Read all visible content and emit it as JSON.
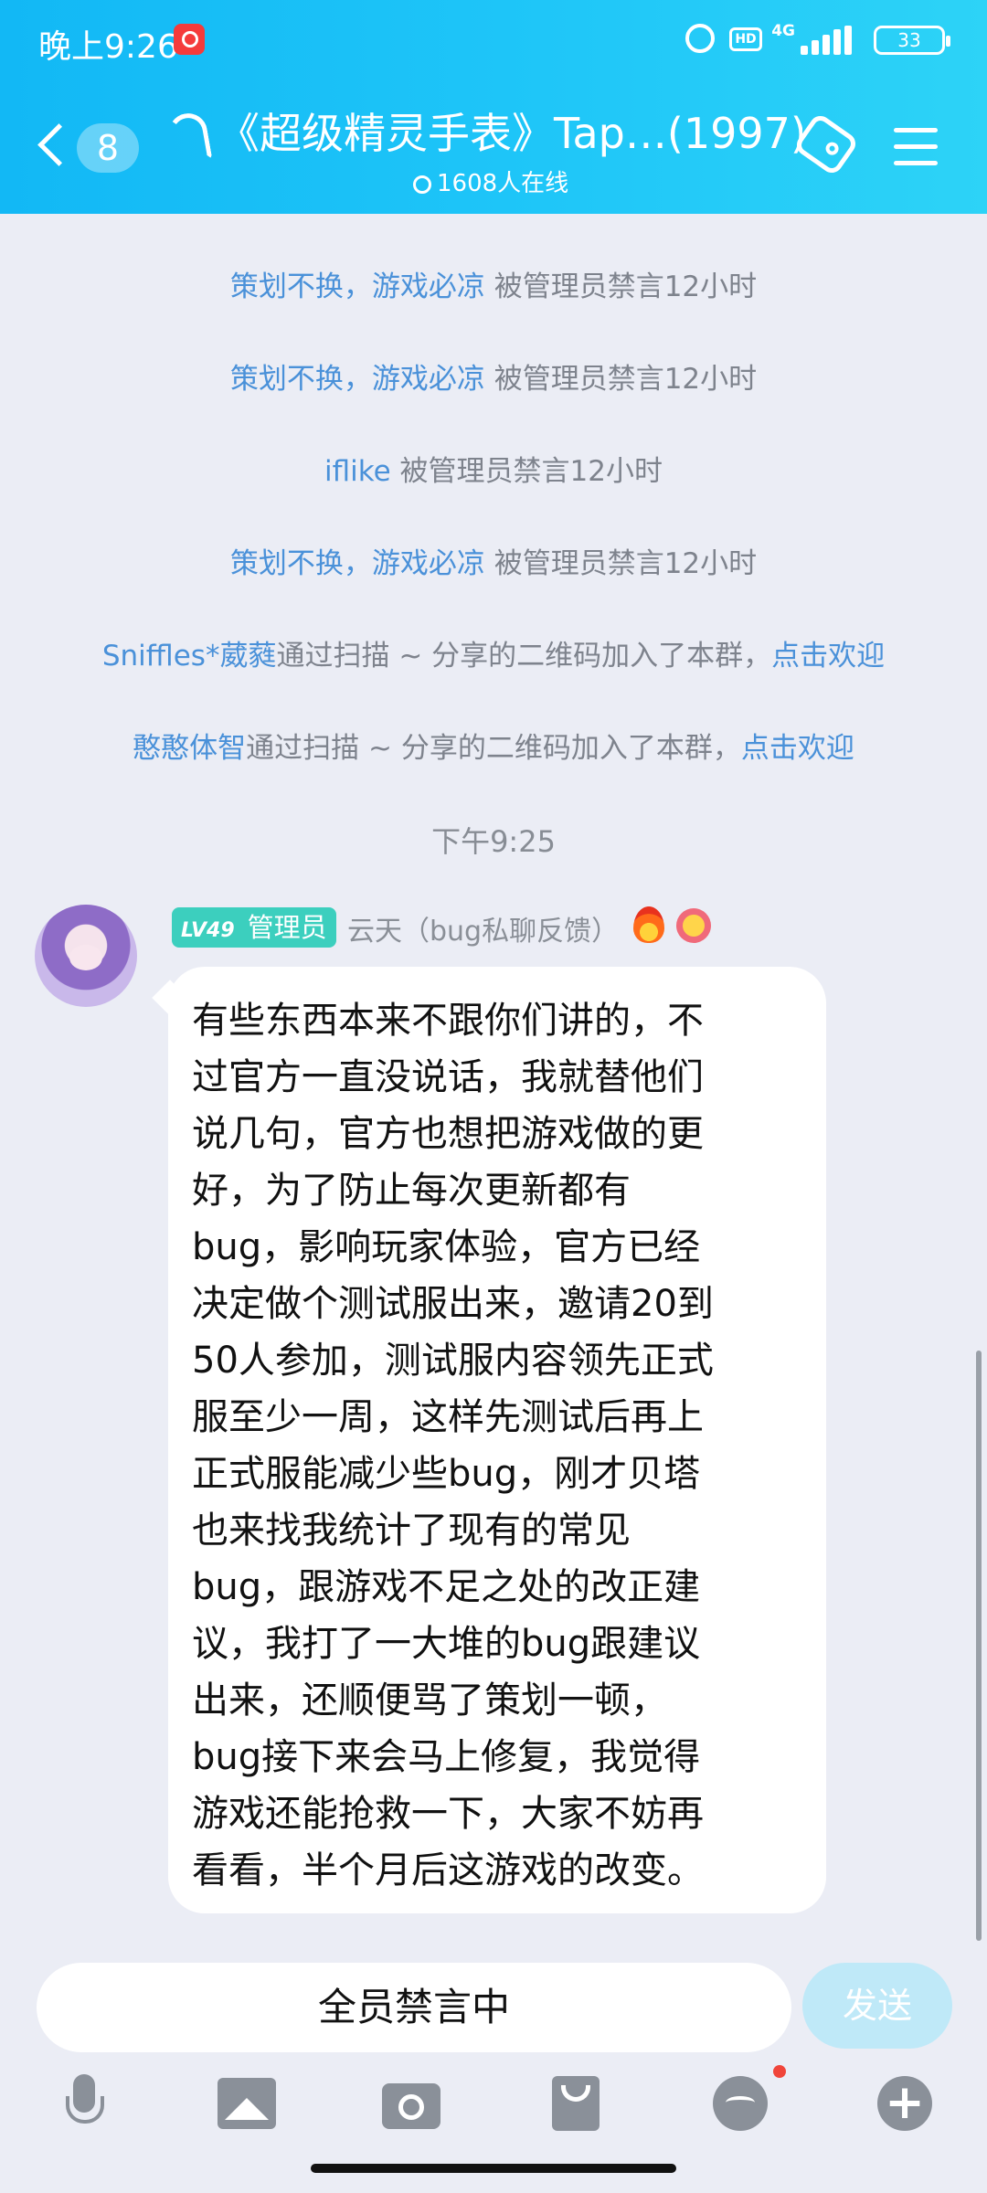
{
  "status_bar": {
    "time": "晚上9:26",
    "network": "4G",
    "hd": "HD",
    "battery": "33"
  },
  "header": {
    "unread_count": "8",
    "title": "《超级精灵手表》Tap…(1997)",
    "online": "1608人在线"
  },
  "system_messages": [
    {
      "name": "策划不换，游戏必凉",
      "text": " 被管理员禁言12小时",
      "link": ""
    },
    {
      "name": "策划不换，游戏必凉",
      "text": " 被管理员禁言12小时",
      "link": ""
    },
    {
      "name": "iflike",
      "text": " 被管理员禁言12小时",
      "link": ""
    },
    {
      "name": "策划不换，游戏必凉",
      "text": " 被管理员禁言12小时",
      "link": ""
    },
    {
      "name": "Sniffles*葳蕤",
      "text": "通过扫描 ~ 分享的二维码加入了本群，",
      "link": "点击欢迎"
    },
    {
      "name": "憨憨体智",
      "text": "通过扫描 ~ 分享的二维码加入了本群，",
      "link": "点击欢迎"
    }
  ],
  "timestamp": "下午9:25",
  "message": {
    "level": "LV49",
    "role": "管理员",
    "sender": "云天（bug私聊反馈）",
    "text": "有些东西本来不跟你们讲的，不\n过官方一直没说话，我就替他们\n说几句，官方也想把游戏做的更\n好，为了防止每次更新都有\nbug，影响玩家体验，官方已经\n决定做个测试服出来，邀请20到\n50人参加，测试服内容领先正式\n服至少一周，这样先测试后再上\n正式服能减少些bug，刚才贝塔\n也来找我统计了现有的常见\nbug，跟游戏不足之处的改正建\n议，我打了一大堆的bug跟建议\n出来，还顺便骂了策划一顿，\nbug接下来会马上修复，我觉得\n游戏还能抢救一下，大家不妨再\n看看，半个月后这游戏的改变。"
  },
  "input": {
    "placeholder": "全员禁言中",
    "send_label": "发送"
  },
  "toolbar": {
    "icons": [
      "microphone-icon",
      "image-icon",
      "camera-icon",
      "red-packet-icon",
      "emoji-icon",
      "plus-icon"
    ]
  },
  "colors": {
    "header": "#1fc6f8",
    "link": "#4a91d9",
    "admin_badge": "#3ccfbe",
    "send_disabled": "#bfe9f8"
  }
}
